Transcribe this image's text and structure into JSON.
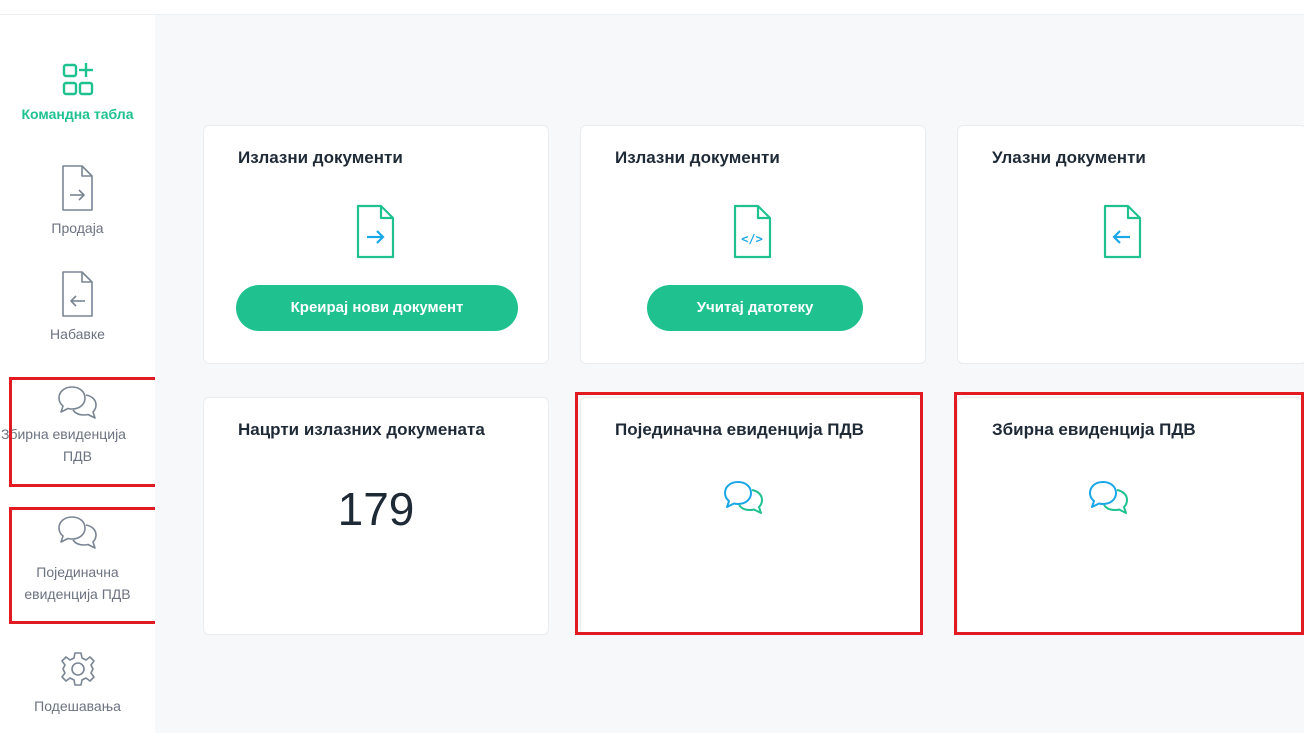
{
  "sidebar": {
    "items": [
      {
        "label": "Командна табла",
        "icon": "dashboard-icon"
      },
      {
        "label": "Продаја",
        "icon": "document-arrow-right-icon"
      },
      {
        "label": "Набавке",
        "icon": "document-arrow-left-icon"
      },
      {
        "label_line1": "Збирна евиденција",
        "label_line2": "ПДВ",
        "icon": "chat-bubbles-icon"
      },
      {
        "label_line1": "Појединачна",
        "label_line2": "евиденција ПДВ",
        "icon": "chat-bubbles-icon"
      },
      {
        "label": "Подешавања",
        "icon": "gear-icon"
      }
    ]
  },
  "cards": {
    "outgoing_create": {
      "title": "Излазни документи",
      "button": "Креирај нови документ",
      "icon": "document-arrow-right-icon"
    },
    "outgoing_upload": {
      "title": "Излазни документи",
      "button": "Учитај датотеку",
      "icon": "document-code-icon"
    },
    "incoming": {
      "title": "Улазни документи",
      "icon": "document-arrow-left-icon"
    },
    "drafts": {
      "title": "Нацрти излазних докумената",
      "count": "179"
    },
    "individual_vat": {
      "title": "Појединачна евиденција ПДВ",
      "icon": "chat-bubbles-icon"
    },
    "summary_vat": {
      "title": "Збирна евиденција ПДВ",
      "icon": "chat-bubbles-icon"
    }
  },
  "colors": {
    "accent": "#1fc28f",
    "accent_blue": "#1aa7e8",
    "highlight": "#e21b23",
    "muted": "#6b7280"
  }
}
